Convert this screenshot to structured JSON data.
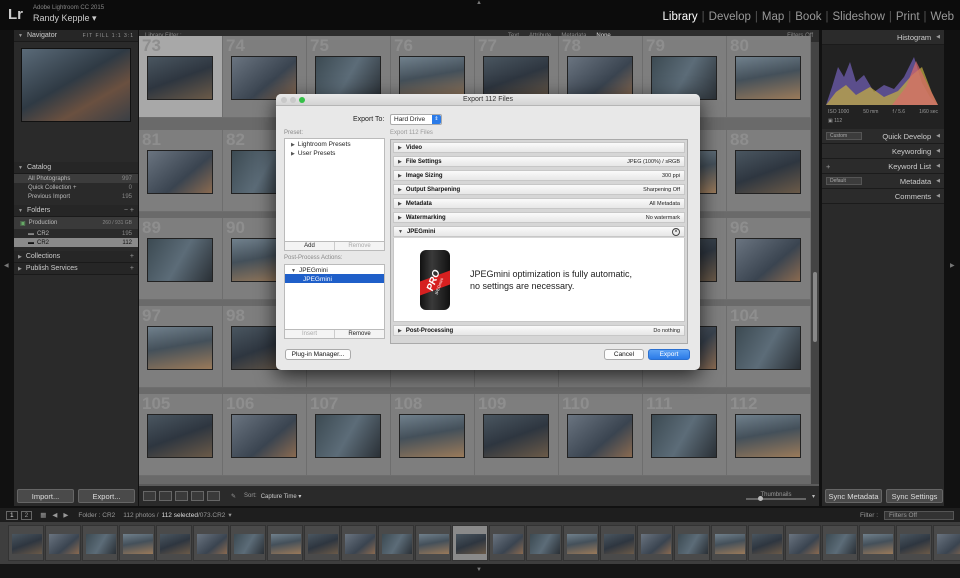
{
  "app": {
    "logo": "Lr",
    "name": "Adobe Lightroom CC 2015",
    "user": "Randy Kepple"
  },
  "modules": [
    "Library",
    "Develop",
    "Map",
    "Book",
    "Slideshow",
    "Print",
    "Web"
  ],
  "left": {
    "navigator": {
      "title": "Navigator",
      "zoom": [
        "FIT",
        "FILL",
        "1:1",
        "3:1"
      ]
    },
    "catalog": {
      "title": "Catalog",
      "items": [
        {
          "label": "All Photographs",
          "count": "997"
        },
        {
          "label": "Quick Collection +",
          "count": "0"
        },
        {
          "label": "Previous Import",
          "count": "195"
        }
      ]
    },
    "folders": {
      "title": "Folders",
      "volume": "Production",
      "volume_size": "260 / 931 GB",
      "items": [
        {
          "label": "CR2",
          "count": "195"
        },
        {
          "label": "CR2",
          "count": "112"
        }
      ]
    },
    "collections": "Collections",
    "publish": "Publish Services",
    "import": "Import...",
    "export": "Export..."
  },
  "filterbar": {
    "title": "Library Filter :",
    "options": [
      "Text",
      "Attribute",
      "Metadata",
      "None"
    ],
    "status": "Filters Off"
  },
  "grid": {
    "row1": [
      "73",
      "74",
      "75",
      "76",
      "77",
      "78",
      "79",
      "80"
    ],
    "row2": [
      "81",
      "82",
      "83",
      "84",
      "85",
      "86",
      "87",
      "88"
    ],
    "row3": [
      "89",
      "90",
      "91",
      "92",
      "93",
      "94",
      "95",
      "96"
    ],
    "row4": [
      "97",
      "98",
      "99",
      "100",
      "101",
      "102",
      "103",
      "104"
    ],
    "row5": [
      "105",
      "106",
      "107",
      "108",
      "109",
      "110",
      "111",
      "112"
    ]
  },
  "toolbar": {
    "sort_label": "Sort:",
    "sort_value": "Capture Time",
    "thumbs": "Thumbnails"
  },
  "right": {
    "histogram": {
      "title": "Histogram",
      "iso": "ISO 1000",
      "focal": "50 mm",
      "aperture": "f / 5.6",
      "shutter": "1/60 sec",
      "mode": "112"
    },
    "quick_develop": {
      "preset": "Custom",
      "label": "Quick Develop"
    },
    "keywording": "Keywording",
    "keyword_list": "Keyword List",
    "metadata": {
      "preset": "Default",
      "label": "Metadata"
    },
    "comments": "Comments",
    "sync_metadata": "Sync Metadata",
    "sync_settings": "Sync Settings"
  },
  "filmstrip": {
    "pages": [
      "1",
      "2"
    ],
    "folder": "Folder : CR2",
    "photos": "112 photos /",
    "selected": "112 selected",
    "file": "/073.CR2",
    "filter_label": "Filter :",
    "filter_value": "Filters Off"
  },
  "dialog": {
    "title": "Export 112 Files",
    "export_to_label": "Export To:",
    "export_to_value": "Hard Drive",
    "preset_label": "Preset:",
    "presets": [
      "Lightroom Presets",
      "User Presets"
    ],
    "add": "Add",
    "remove": "Remove",
    "pp_label": "Post-Process Actions:",
    "pp_items": [
      "JPEGmini",
      "JPEGmini"
    ],
    "insert": "Insert",
    "pp_remove": "Remove",
    "right_label": "Export 112 Files",
    "sections": [
      {
        "name": "Video",
        "value": ""
      },
      {
        "name": "File Settings",
        "value": "JPEG (100%) / sRGB"
      },
      {
        "name": "Image Sizing",
        "value": "300 ppi"
      },
      {
        "name": "Output Sharpening",
        "value": "Sharpening Off"
      },
      {
        "name": "Metadata",
        "value": "All Metadata"
      },
      {
        "name": "Watermarking",
        "value": "No watermark"
      }
    ],
    "jpegmini": {
      "name": "JPEGmini",
      "can_text": "PRO",
      "can_brand": "JPEGmini",
      "line1": "JPEGmini optimization is fully automatic,",
      "line2": "no settings are necessary."
    },
    "postproc": {
      "name": "Post-Processing",
      "value": "Do nothing"
    },
    "plugin": "Plug-in Manager...",
    "cancel": "Cancel",
    "export": "Export"
  }
}
